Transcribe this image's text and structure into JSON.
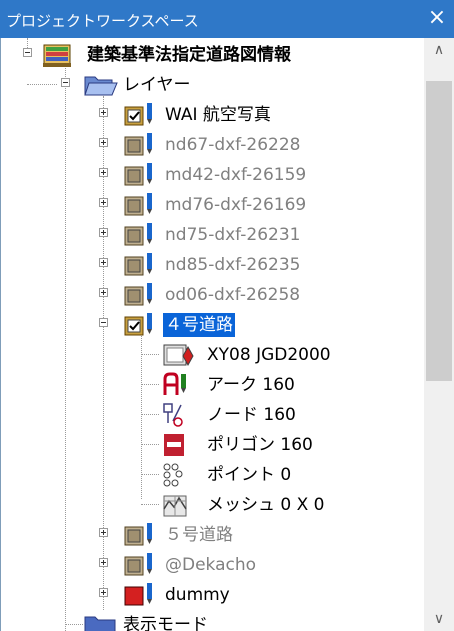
{
  "window": {
    "title": "プロジェクトワークスペース",
    "close_icon": "close-icon"
  },
  "tree": {
    "root": {
      "label": "建築基準法指定道路図情報",
      "icon": "database-stack-icon"
    },
    "layers_folder": {
      "label": "レイヤー",
      "icon": "open-folder-icon"
    },
    "layers": [
      {
        "label": "WAI 航空写真",
        "visible": true,
        "dimmed": false
      },
      {
        "label": "nd67-dxf-26228",
        "visible": false,
        "dimmed": true
      },
      {
        "label": "md42-dxf-26159",
        "visible": false,
        "dimmed": true
      },
      {
        "label": "md76-dxf-26169",
        "visible": false,
        "dimmed": true
      },
      {
        "label": "nd75-dxf-26231",
        "visible": false,
        "dimmed": true
      },
      {
        "label": "nd85-dxf-26235",
        "visible": false,
        "dimmed": true
      },
      {
        "label": "od06-dxf-26258",
        "visible": false,
        "dimmed": true
      },
      {
        "label": "４号道路",
        "visible": true,
        "dimmed": false,
        "selected": true,
        "expanded": true
      }
    ],
    "selected_children": [
      {
        "label": "XY08 JGD2000",
        "icon": "coordinate-system-icon"
      },
      {
        "label": "アーク  160",
        "icon": "arc-icon"
      },
      {
        "label": "ノード  160",
        "icon": "node-icon"
      },
      {
        "label": "ポリゴン  160",
        "icon": "polygon-icon"
      },
      {
        "label": "ポイント  0",
        "icon": "point-icon"
      },
      {
        "label": "メッシュ 0 X 0",
        "icon": "mesh-icon"
      }
    ],
    "more_layers": [
      {
        "label": "５号道路",
        "dimmed": true
      },
      {
        "label": "@Dekacho",
        "dimmed": true
      },
      {
        "label": "dummy",
        "dimmed": false,
        "color": "#d42020"
      }
    ],
    "display_mode": {
      "label": "表示モード",
      "icon": "closed-folder-icon"
    }
  },
  "colors": {
    "titlebar": "#2f78c8",
    "selection": "#0a64d8",
    "dimmed_text": "#808080",
    "layer_pen": "#1a66cc"
  }
}
